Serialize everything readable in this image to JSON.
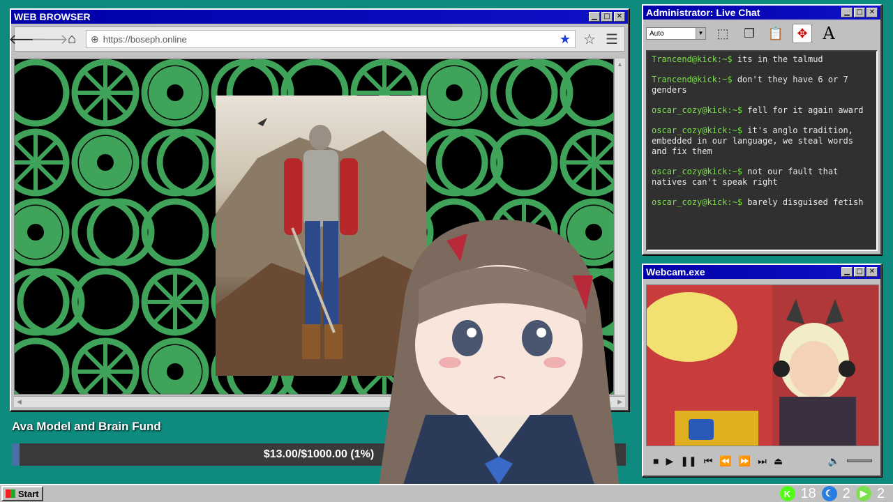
{
  "browser": {
    "title": "WEB BROWSER",
    "url": "https://boseph.online",
    "colors": {
      "pattern": "#3fa35a",
      "background": "#000000"
    }
  },
  "fund": {
    "title": "Ava Model and Brain Fund",
    "progress_text": "$13.00/$1000.00 (1%)",
    "progress_fraction": 0.013
  },
  "chat": {
    "title": "Administrator: Live Chat",
    "select_value": "Auto",
    "messages": [
      {
        "user": "Trancend@kick:~$",
        "text": "its in the talmud"
      },
      {
        "user": "Trancend@kick:~$",
        "text": "don't they have 6 or 7 genders"
      },
      {
        "user": "oscar_cozy@kick:~$",
        "text": "fell for it again award"
      },
      {
        "user": "oscar_cozy@kick:~$",
        "text": "it's anglo tradition, embedded in our language, we steal words and fix them"
      },
      {
        "user": "oscar_cozy@kick:~$",
        "text": "not our fault that natives can't speak right"
      },
      {
        "user": "oscar_cozy@kick:~$",
        "text": "barely disguised fetish"
      }
    ]
  },
  "webcam": {
    "title": "Webcam.exe"
  },
  "taskbar": {
    "start_label": "Start",
    "tray": [
      {
        "icon": "kick-icon",
        "count": "18",
        "color": "#53fc18"
      },
      {
        "icon": "moon-icon",
        "count": "2",
        "color": "#2a7de1"
      },
      {
        "icon": "play-icon",
        "count": "2",
        "color": "#7be04b"
      }
    ]
  }
}
